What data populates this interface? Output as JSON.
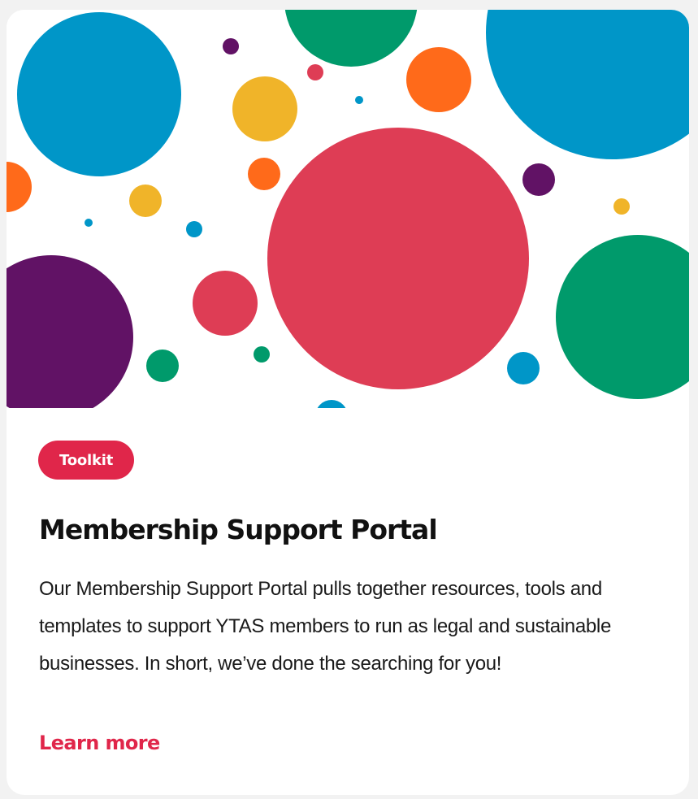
{
  "card": {
    "badge_label": "Toolkit",
    "title": "Membership Support Portal",
    "description": "Our Membership Support Portal pulls together resources, tools and templates to support YTAS members to run as legal and sustainable businesses. In short, we’ve done the searching for you!",
    "link_label": "Learn more"
  },
  "colors": {
    "accent": "#e0264a",
    "blue": "#0096c8",
    "green": "#009a6b",
    "red": "#de3d55",
    "orange": "#ff6a1a",
    "yellow": "#f0b429",
    "purple": "#611265",
    "page_background": "#f2f2f2",
    "card_background": "#ffffff"
  },
  "hero": {
    "image": "confetti-dots-illustration"
  }
}
